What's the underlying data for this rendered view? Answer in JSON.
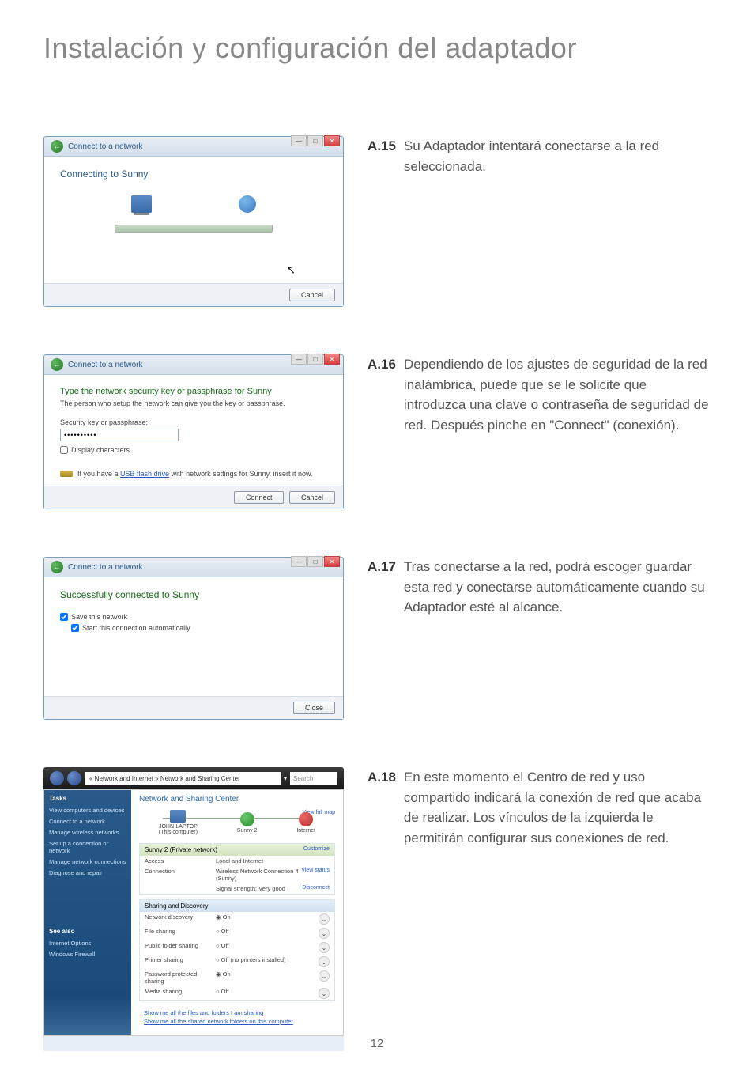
{
  "page": {
    "title": "Instalación y configuración del adaptador",
    "number": "12"
  },
  "steps": {
    "a15": {
      "num": "A.15",
      "text": "Su Adaptador intentará conectarse a la red seleccionada."
    },
    "a16": {
      "num": "A.16",
      "text": "Dependiendo de los ajustes de seguridad de la red inalámbrica, puede que se le solicite que introduzca una clave o contraseña de seguridad de red. Después pinche en \"Connect\" (conexión)."
    },
    "a17": {
      "num": "A.17",
      "text": "Tras conectarse a la red, podrá escoger guardar esta red y conectarse automáticamente cuando su Adaptador esté al alcance."
    },
    "a18": {
      "num": "A.18",
      "text": "En este momento el Centro de red y uso compartido indicará la conexión de red que acaba de realizar. Los vínculos de la izquierda le permitirán configurar sus conexiones de red."
    }
  },
  "dialog1": {
    "header": "Connect to a network",
    "connecting": "Connecting to Sunny",
    "cancel": "Cancel"
  },
  "dialog2": {
    "header": "Connect to a network",
    "heading": "Type the network security key or passphrase for Sunny",
    "sub": "The person who setup the network can give you the key or passphrase.",
    "label": "Security key or passphrase:",
    "value": "••••••••••",
    "display_chars": "Display characters",
    "usb_pre": "If you have a ",
    "usb_link": "USB flash drive",
    "usb_post": " with network settings for Sunny, insert it now.",
    "connect": "Connect",
    "cancel": "Cancel"
  },
  "dialog3": {
    "header": "Connect to a network",
    "heading": "Successfully connected to Sunny",
    "save": "Save this network",
    "auto": "Start this connection automatically",
    "close": "Close"
  },
  "dialog4": {
    "breadcrumb": "« Network and Internet » Network and Sharing Center",
    "search": "Search",
    "tasks_hdr": "Tasks",
    "tasks": [
      "View computers and devices",
      "Connect to a network",
      "Manage wireless networks",
      "Set up a connection or network",
      "Manage network connections",
      "Diagnose and repair"
    ],
    "seealso": "See also",
    "seealso_items": [
      "Internet Options",
      "Windows Firewall"
    ],
    "main_title": "Network and Sharing Center",
    "view_full_map": "View full map",
    "diag_computer": "JOHN-LAPTOP",
    "diag_computer_sub": "(This computer)",
    "diag_network": "Sunny 2",
    "diag_internet": "Internet",
    "net_section": "Sunny 2 (Private network)",
    "customize": "Customize",
    "access_label": "Access",
    "access_value": "Local and Internet",
    "conn_label": "Connection",
    "conn_value": "Wireless Network Connection 4 (Sunny)",
    "signal": "Signal strength: Very good",
    "view_status": "View status",
    "disconnect": "Disconnect",
    "sharing_hdr": "Sharing and Discovery",
    "rows": [
      {
        "label": "Network discovery",
        "value": "◉ On"
      },
      {
        "label": "File sharing",
        "value": "○ Off"
      },
      {
        "label": "Public folder sharing",
        "value": "○ Off"
      },
      {
        "label": "Printer sharing",
        "value": "○ Off (no printers installed)"
      },
      {
        "label": "Password protected sharing",
        "value": "◉ On"
      },
      {
        "label": "Media sharing",
        "value": "○ Off"
      }
    ],
    "bottom1": "Show me all the files and folders I am sharing",
    "bottom2": "Show me all the shared network folders on this computer"
  }
}
